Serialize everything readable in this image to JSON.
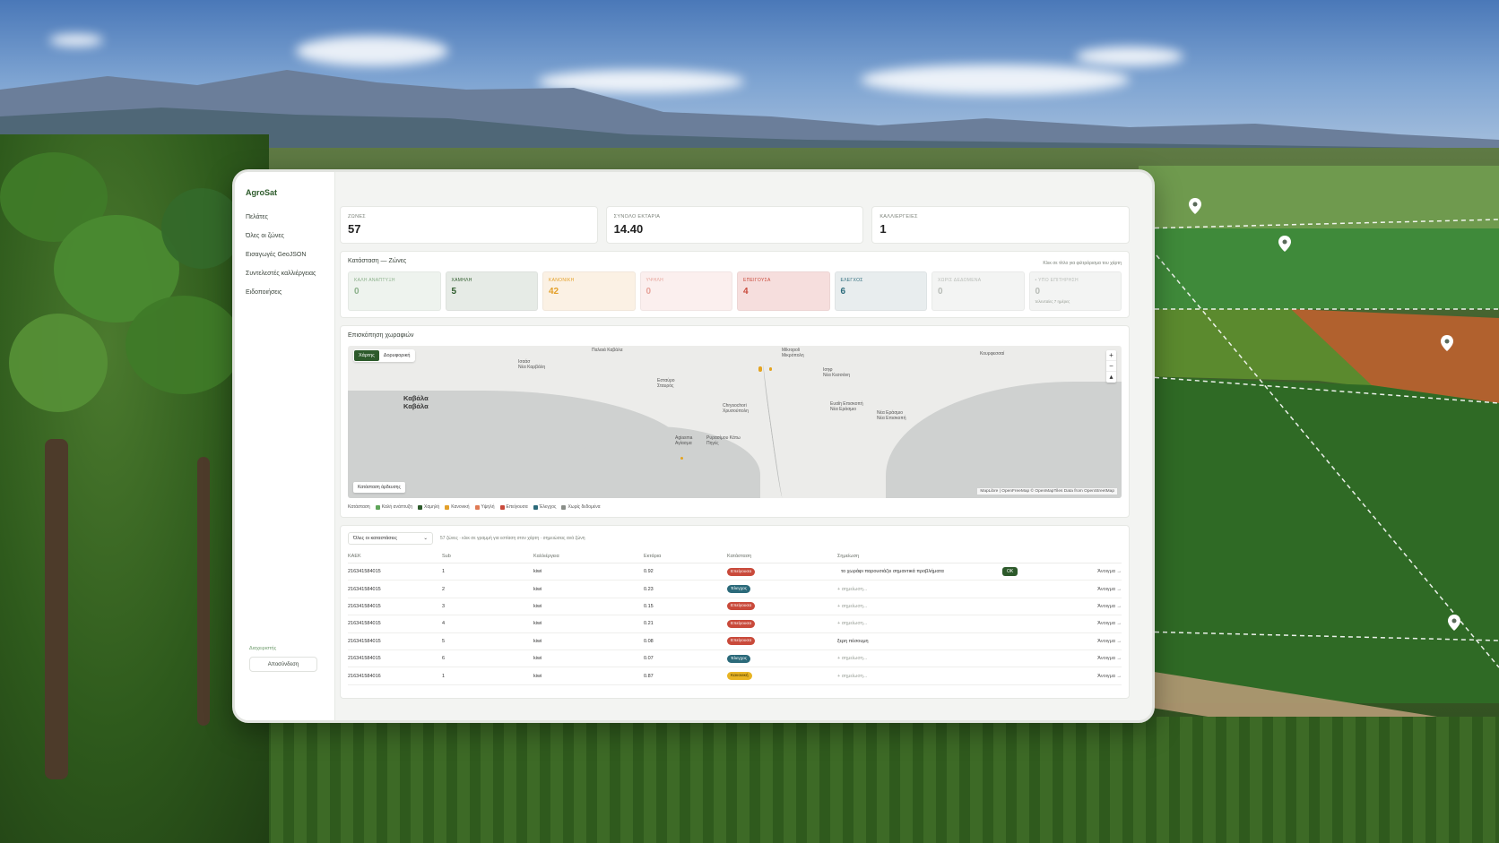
{
  "app": {
    "brand": "AgroSat"
  },
  "sidebar": {
    "items": [
      {
        "label": "Πελάτες"
      },
      {
        "label": "Όλες οι ζώνες"
      },
      {
        "label": "Εισαγωγές GeoJSON"
      },
      {
        "label": "Συντελεστές καλλιέργειας"
      },
      {
        "label": "Ειδοποιήσεις"
      }
    ],
    "bottom_link": "Διαχειριστής",
    "logout": "Αποσύνδεση"
  },
  "stats": [
    {
      "label": "ΖΩΝΕΣ",
      "value": "57"
    },
    {
      "label": "ΣΥΝΟΛΟ ΕΚΤΑΡΙΑ",
      "value": "14.40"
    },
    {
      "label": "ΚΑΛΛΙΕΡΓΕΙΕΣ",
      "value": "1"
    }
  ],
  "status_panel": {
    "title": "Κατάσταση — Ζώνες",
    "hint": "Κλικ σε τίτλο για φιλτράρισμα του χάρτη",
    "cards": [
      {
        "label": "ΚΑΛΗ ΑΝΑΠΤΥΞΗ",
        "value": "0",
        "bg": "#eef3ee",
        "fg": "#8bb08a"
      },
      {
        "label": "ΧΑΜΗΛΗ",
        "value": "5",
        "bg": "#e6ebe6",
        "fg": "#2c5a2a"
      },
      {
        "label": "ΚΑΝΟΝΙΚΗ",
        "value": "42",
        "bg": "#fbf1e4",
        "fg": "#e3a02a"
      },
      {
        "label": "ΥΨΗΛΗ",
        "value": "0",
        "bg": "#fbefee",
        "fg": "#e6a39a"
      },
      {
        "label": "ΕΠΕΙΓΟΥΣΑ",
        "value": "4",
        "bg": "#f6dedd",
        "fg": "#c94a3b"
      },
      {
        "label": "ΕΛΕΓΧΟΣ",
        "value": "6",
        "bg": "#e8edee",
        "fg": "#2b6a7a"
      },
      {
        "label": "ΧΩΡΙΣ ΔΕΔΟΜΕΝΑ",
        "value": "0",
        "bg": "#f3f4f3",
        "fg": "#b8bcb7"
      },
      {
        "label": "• ΥΠΟ ΕΠΙΤΗΡΗΣΗ",
        "value": "0",
        "sub": "τελευταίες 7 ημέρες",
        "bg": "#f3f4f3",
        "fg": "#b8bcb7"
      }
    ]
  },
  "map_panel": {
    "title": "Επισκόπηση χωραφιών",
    "toggle": [
      "Χάρτης",
      "Δορυφορική"
    ],
    "state_btn": "Κατάσταση άρδευσης",
    "attribution": "MapLibre | OpenFreeMap © OpenMapTiles Data from OpenStreetMap",
    "labels": {
      "kavala": "Καβάλα\nΚαβάλα",
      "nea_karvali": "Ισαάσ\nΝέα Καρβάλη",
      "palaia": "Παλαιά Καβάλα",
      "estavros": "Εσταύρο\nΣταυρός",
      "chrysoupoli": "Chrysochori\nΧρυσούπολη",
      "mikropoli": "Mikropoli\nΜικρόπολη",
      "agiasma": "Agiasma\nΑγίασμα",
      "pigi": "Ρυρασίμου Κάτω\nΠηγές",
      "nea_kessani": "Ισηφ\nΝέα Κεσσάνη",
      "eratino": "Ευαΐη Επισκοπή\nΝέα Εράσμιο",
      "abdira": "Κουρφεσσαί",
      "kerami": "Νέα Εράσμιο\nΝέα Επισκοπή"
    },
    "legend_title": "Κατάσταση",
    "legend": [
      {
        "label": "Καλή ανάπτυξη",
        "color": "#5fa55a"
      },
      {
        "label": "Χαμηλή",
        "color": "#2c5a2a"
      },
      {
        "label": "Κανονική",
        "color": "#e3a02a"
      },
      {
        "label": "Υψηλή",
        "color": "#e07b55"
      },
      {
        "label": "Επείγουσα",
        "color": "#c94a3b"
      },
      {
        "label": "Έλεγχος",
        "color": "#2b6a7a"
      },
      {
        "label": "Χωρίς δεδομένα",
        "color": "#8a8e89"
      }
    ]
  },
  "table_panel": {
    "select_value": "Όλες οι καταστάσεις",
    "hint": "57 ζώνες · κλικ σε γραμμή για εστίαση στον χάρτη · σημειώσεις ανά ζώνη",
    "columns": [
      "ΚΑΕΚ",
      "Sub",
      "Καλλιέργεια",
      "Εκτάρια",
      "Κατάσταση",
      "Σημείωση"
    ],
    "rows": [
      {
        "kaek": "216341584015",
        "sub": "1",
        "crop": "kiwi",
        "ha": "0.92",
        "status": "Επείγουσα",
        "cls": "red",
        "note": "το χωράφι παρουσιάζει σημαντικά προβλήματα",
        "note_mode": "edit",
        "ok": "OK",
        "open": "Άνοιγμα →"
      },
      {
        "kaek": "216341584015",
        "sub": "2",
        "crop": "kiwi",
        "ha": "0.23",
        "status": "Έλεγχος",
        "cls": "teal",
        "note": "+ σημείωση...",
        "note_mode": "muted",
        "open": "Άνοιγμα →"
      },
      {
        "kaek": "216341584015",
        "sub": "3",
        "crop": "kiwi",
        "ha": "0.15",
        "status": "Επείγουσα",
        "cls": "red",
        "note": "+ σημείωση...",
        "note_mode": "muted",
        "open": "Άνοιγμα →"
      },
      {
        "kaek": "216341584015",
        "sub": "4",
        "crop": "kiwi",
        "ha": "0.21",
        "status": "Επείγουσα",
        "cls": "red",
        "note": "+ σημείωση...",
        "note_mode": "muted",
        "open": "Άνοιγμα →"
      },
      {
        "kaek": "216341584015",
        "sub": "5",
        "crop": "kiwi",
        "ha": "0.08",
        "status": "Επείγουσα",
        "cls": "red",
        "note": "ξερη πέσουμη",
        "note_mode": "text",
        "open": "Άνοιγμα →"
      },
      {
        "kaek": "216341584015",
        "sub": "6",
        "crop": "kiwi",
        "ha": "0.07",
        "status": "Έλεγχος",
        "cls": "teal",
        "note": "+ σημείωση...",
        "note_mode": "muted",
        "open": "Άνοιγμα →"
      },
      {
        "kaek": "216341584016",
        "sub": "1",
        "crop": "kiwi",
        "ha": "0.87",
        "status": "Κανονική",
        "cls": "yellow",
        "note": "+ σημείωση...",
        "note_mode": "muted",
        "open": "Άνοιγμα →"
      }
    ]
  }
}
